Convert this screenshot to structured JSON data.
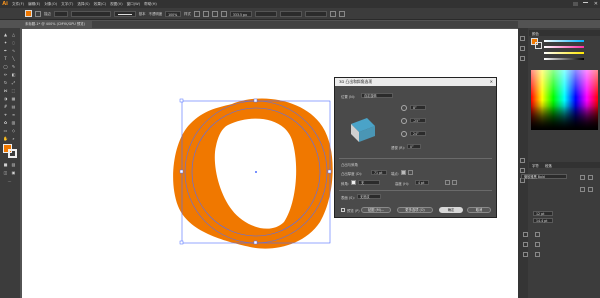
{
  "app": {
    "logo": "Ai",
    "menus": [
      "文件(F)",
      "编辑(E)",
      "对象(O)",
      "文字(T)",
      "选择(S)",
      "效果(C)",
      "视图(V)",
      "窗口(W)",
      "帮助(H)"
    ]
  },
  "control_bar": {
    "fill_color": "#f07800",
    "stroke_label": "描边",
    "stroke_value": "",
    "brush_label": "基本",
    "opacity_label": "不透明度",
    "opacity_value": "100%",
    "style_label": "样式",
    "x_value": "333.5 px",
    "y_value": "",
    "w_value": "",
    "h_value": ""
  },
  "document": {
    "tab_title": "未标题-1* @ 400% (CMYK/GPU 预览)"
  },
  "canvas": {
    "shape_color": "#f07800",
    "highlight_color": "#0058ff"
  },
  "dialog": {
    "title": "3D 凸出和斜角选项",
    "position_label": "位置 (N):",
    "position_value": "自定旋转",
    "rotate_x": "8°",
    "rotate_y": "-25°",
    "rotate_z": "24°",
    "perspective_label": "透视 (R):",
    "perspective_value": "0°",
    "extrude_section": "凸出与斜角",
    "extrude_depth_label": "凸出厚度 (D):",
    "extrude_depth_value": "71 pt",
    "cap_label": "端点:",
    "bevel_label": "斜角:",
    "bevel_value": "无",
    "height_label": "高度 (H):",
    "height_value": "4 pt",
    "surface_label": "表面 (S):",
    "surface_value": "无底纹",
    "preview_label": "预览 (P)",
    "map_art_button": "贴图 (M)...",
    "more_options_button": "更多选项 (O)",
    "ok_button": "确定",
    "cancel_button": "取消",
    "cube_top_color": "#4aa3c8",
    "cube_side_color": "#d0d0d0",
    "cube_front_color": "#a0a0a0"
  },
  "right_panel": {
    "color_tab": "颜色",
    "color_values": [
      "",
      "",
      "",
      ""
    ],
    "char_tab": "字符",
    "para_tab": "段落",
    "font_value": "微软雅黑 Bold",
    "size_values": [
      "12 pt",
      "14.4 pt"
    ]
  }
}
